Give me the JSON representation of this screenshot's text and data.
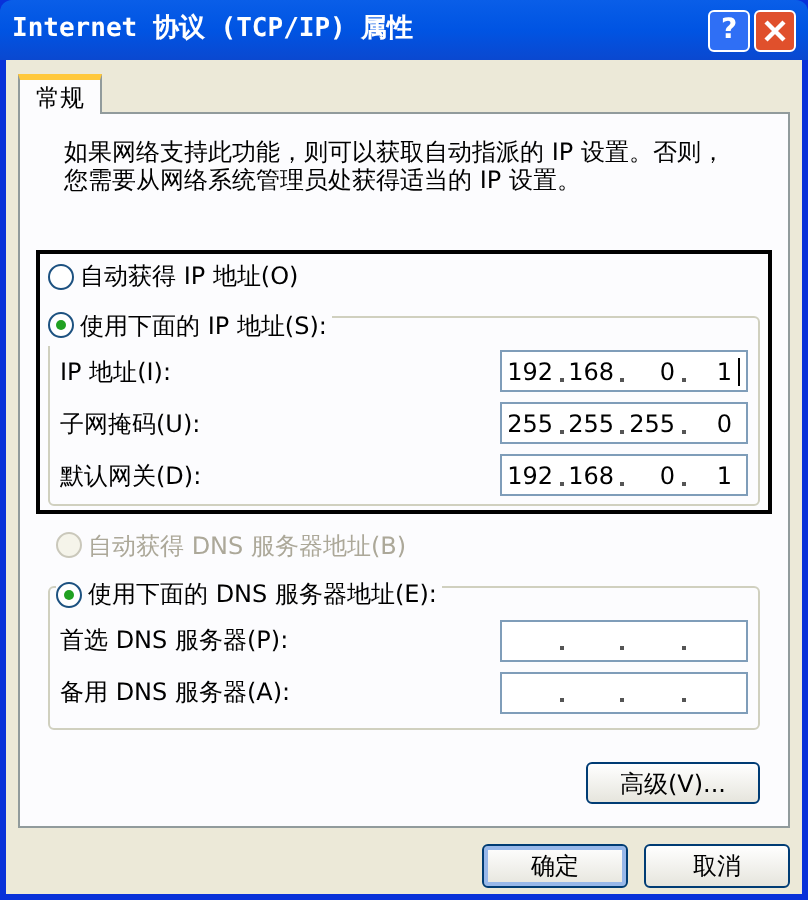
{
  "window": {
    "title": "Internet 协议 (TCP/IP) 属性",
    "help_button": "?"
  },
  "tabs": [
    {
      "label": "常规",
      "selected": true
    }
  ],
  "description": [
    "如果网络支持此功能，则可以获取自动指派的 IP 设置。否则，",
    "您需要从网络系统管理员处获得适当的 IP 设置。"
  ],
  "ip_mode": [
    {
      "label": "自动获得 IP 地址(O)",
      "selected": false,
      "disabled": false
    },
    {
      "label": "使用下面的 IP 地址(S):",
      "selected": true,
      "disabled": false
    }
  ],
  "ip_fields": [
    {
      "label": "IP 地址(I):",
      "octets": [
        "192",
        "168",
        "0",
        "1"
      ],
      "focused": true
    },
    {
      "label": "子网掩码(U):",
      "octets": [
        "255",
        "255",
        "255",
        "0"
      ],
      "focused": false
    },
    {
      "label": "默认网关(D):",
      "octets": [
        "192",
        "168",
        "0",
        "1"
      ],
      "focused": false
    }
  ],
  "dns_mode": [
    {
      "label": "自动获得 DNS 服务器地址(B)",
      "selected": false,
      "disabled": true
    },
    {
      "label": "使用下面的 DNS 服务器地址(E):",
      "selected": true,
      "disabled": false
    }
  ],
  "dns_fields": [
    {
      "label": "首选 DNS 服务器(P):",
      "focused": false
    },
    {
      "label": "备用 DNS 服务器(A):",
      "focused": false
    }
  ],
  "advanced_button": "高级(V)...",
  "buttons": [
    "确定",
    "取消"
  ]
}
